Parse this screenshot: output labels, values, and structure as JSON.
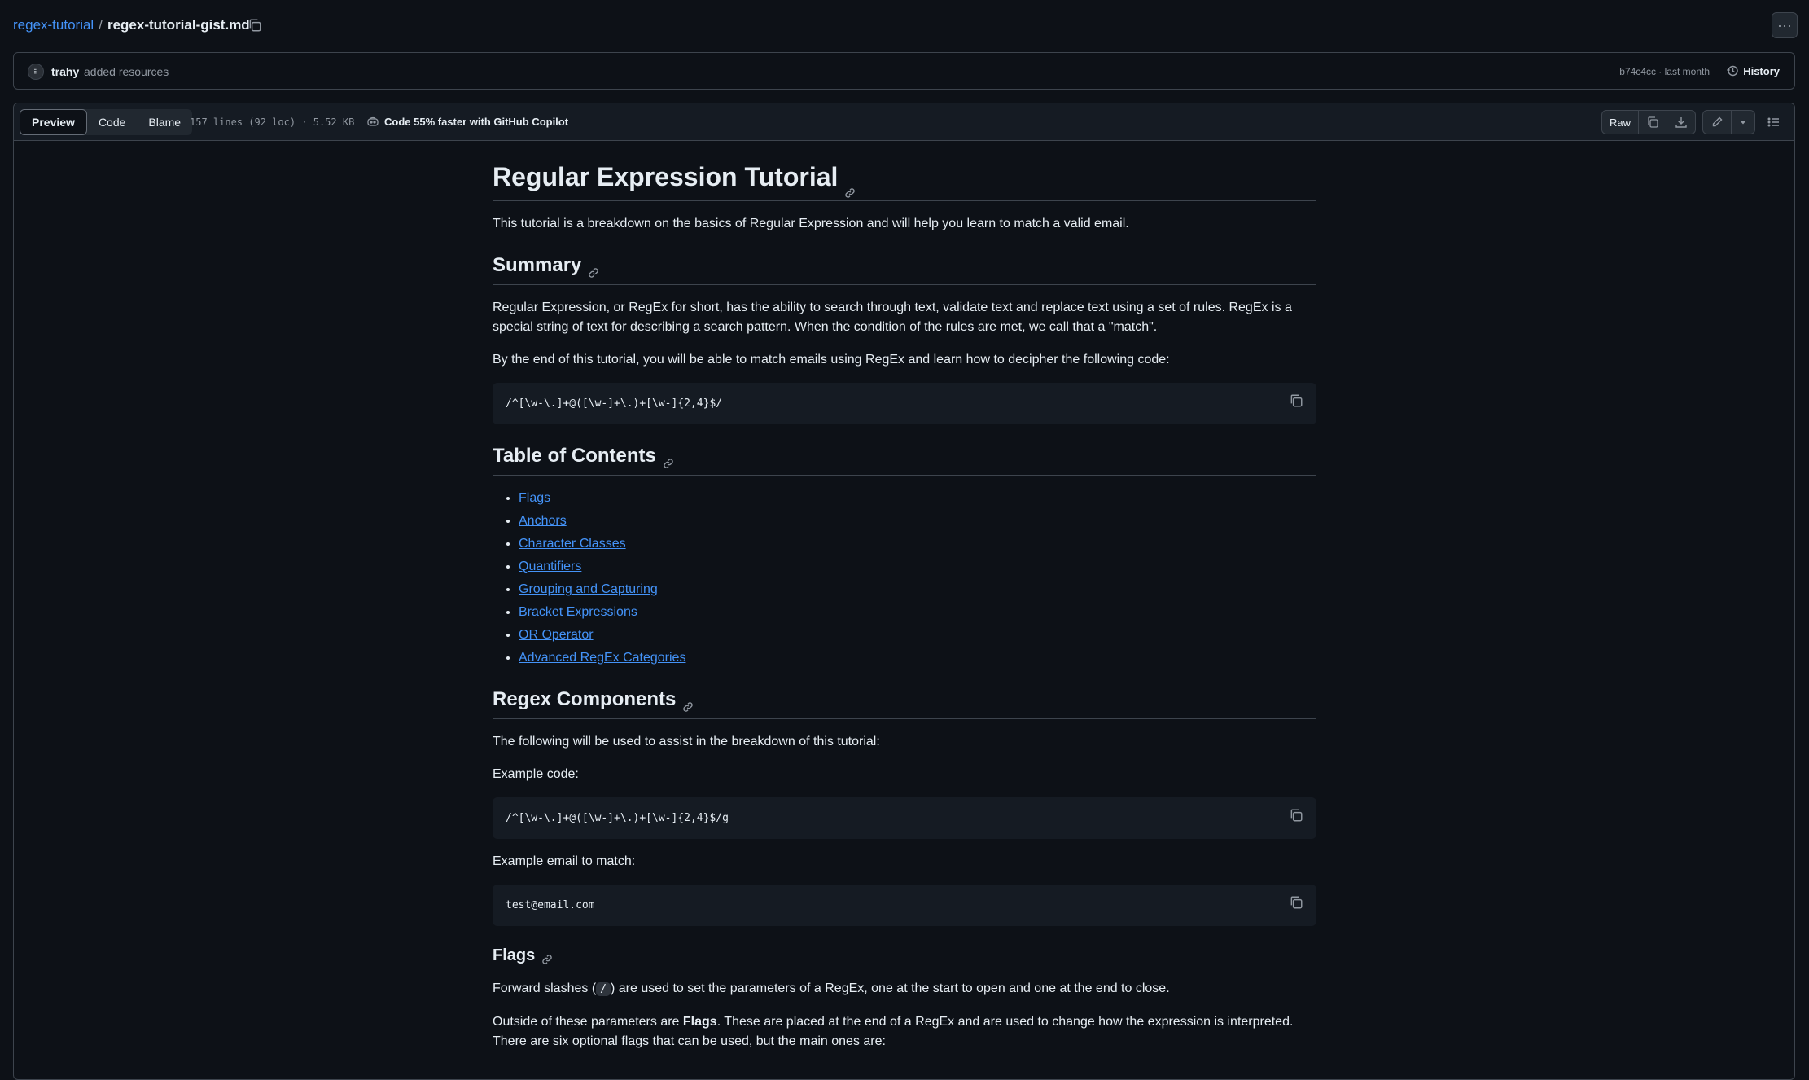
{
  "breadcrumb": {
    "repo": "regex-tutorial",
    "separator": "/",
    "file": "regex-tutorial-gist.md"
  },
  "commit": {
    "avatar": "⠿",
    "author": "trahy",
    "message": "added resources",
    "sha_time": "b74c4cc · last month",
    "history_label": "History"
  },
  "file_header": {
    "tabs": [
      "Preview",
      "Code",
      "Blame"
    ],
    "active_tab": "Preview",
    "lines_info": "157 lines (92 loc) · 5.52 KB",
    "copilot": "Code 55% faster with GitHub Copilot",
    "raw_label": "Raw",
    "more_label": "···"
  },
  "doc": {
    "title": "Regular Expression Tutorial",
    "intro": "This tutorial is a breakdown on the basics of Regular Expression and will help you learn to match a valid email.",
    "summary_heading": "Summary",
    "summary_p1": "Regular Expression, or RegEx for short, has the ability to search through text, validate text and replace text using a set of rules. RegEx is a special string of text for describing a search pattern. When the condition of the rules are met, we call that a \"match\".",
    "summary_p2": "By the end of this tutorial, you will be able to match emails using RegEx and learn how to decipher the following code:",
    "code1": "/^[\\w-\\.]+@([\\w-]+\\.)+[\\w-]{2,4}$/",
    "toc_heading": "Table of Contents",
    "toc": [
      "Flags",
      "Anchors",
      "Character Classes",
      "Quantifiers",
      "Grouping and Capturing",
      "Bracket Expressions",
      "OR Operator",
      "Advanced RegEx Categories"
    ],
    "components_heading": "Regex Components",
    "components_p": "The following will be used to assist in the breakdown of this tutorial:",
    "example_code_label": "Example code:",
    "code2": "/^[\\w-\\.]+@([\\w-]+\\.)+[\\w-]{2,4}$/g",
    "example_email_label": "Example email to match:",
    "code3": "test@email.com",
    "flags_heading": "Flags",
    "flags_p1_before": "Forward slashes (",
    "flags_p1_code": "/",
    "flags_p1_after": ") are used to set the parameters of a RegEx, one at the start to open and one at the end to close.",
    "flags_p2_before": "Outside of these parameters are ",
    "flags_p2_bold": "Flags",
    "flags_p2_after": ". These are placed at the end of a RegEx and are used to change how the expression is interpreted. There are six optional flags that can be used, but the main ones are:"
  }
}
